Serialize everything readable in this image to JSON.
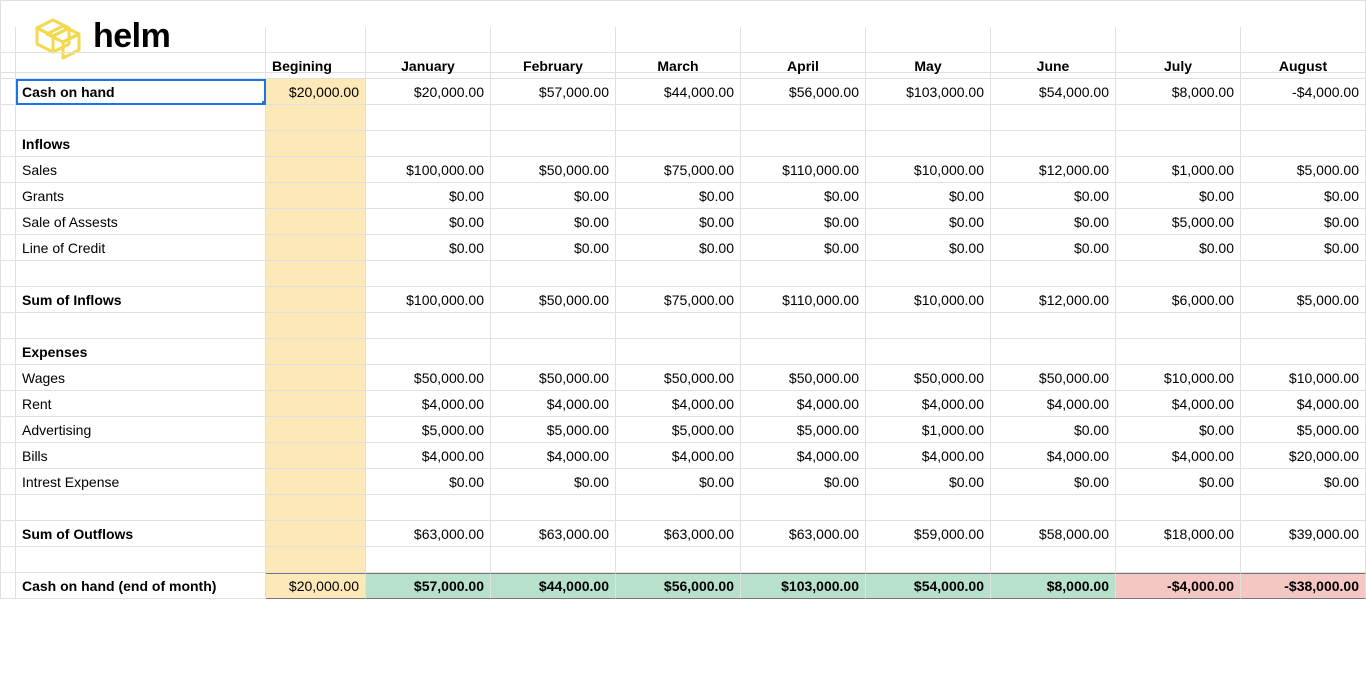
{
  "logo_text": "helm",
  "columns": [
    "Begining",
    "January",
    "February",
    "March",
    "April",
    "May",
    "June",
    "July",
    "August"
  ],
  "rows": {
    "cash_on_hand": {
      "label": "Cash on hand",
      "values": [
        "$20,000.00",
        "$20,000.00",
        "$57,000.00",
        "$44,000.00",
        "$56,000.00",
        "$103,000.00",
        "$54,000.00",
        "$8,000.00",
        "-$4,000.00"
      ]
    },
    "inflows_header": {
      "label": "Inflows"
    },
    "sales": {
      "label": "Sales",
      "values": [
        "",
        "$100,000.00",
        "$50,000.00",
        "$75,000.00",
        "$110,000.00",
        "$10,000.00",
        "$12,000.00",
        "$1,000.00",
        "$5,000.00"
      ]
    },
    "grants": {
      "label": "Grants",
      "values": [
        "",
        "$0.00",
        "$0.00",
        "$0.00",
        "$0.00",
        "$0.00",
        "$0.00",
        "$0.00",
        "$0.00"
      ]
    },
    "sale_assets": {
      "label": "Sale of Assests",
      "values": [
        "",
        "$0.00",
        "$0.00",
        "$0.00",
        "$0.00",
        "$0.00",
        "$0.00",
        "$5,000.00",
        "$0.00"
      ]
    },
    "loc": {
      "label": "Line of Credit",
      "values": [
        "",
        "$0.00",
        "$0.00",
        "$0.00",
        "$0.00",
        "$0.00",
        "$0.00",
        "$0.00",
        "$0.00"
      ]
    },
    "sum_inflows": {
      "label": "Sum of Inflows",
      "values": [
        "",
        "$100,000.00",
        "$50,000.00",
        "$75,000.00",
        "$110,000.00",
        "$10,000.00",
        "$12,000.00",
        "$6,000.00",
        "$5,000.00"
      ]
    },
    "expenses_header": {
      "label": "Expenses"
    },
    "wages": {
      "label": "Wages",
      "values": [
        "",
        "$50,000.00",
        "$50,000.00",
        "$50,000.00",
        "$50,000.00",
        "$50,000.00",
        "$50,000.00",
        "$10,000.00",
        "$10,000.00"
      ]
    },
    "rent": {
      "label": "Rent",
      "values": [
        "",
        "$4,000.00",
        "$4,000.00",
        "$4,000.00",
        "$4,000.00",
        "$4,000.00",
        "$4,000.00",
        "$4,000.00",
        "$4,000.00"
      ]
    },
    "advertising": {
      "label": "Advertising",
      "values": [
        "",
        "$5,000.00",
        "$5,000.00",
        "$5,000.00",
        "$5,000.00",
        "$1,000.00",
        "$0.00",
        "$0.00",
        "$5,000.00"
      ]
    },
    "bills": {
      "label": "Bills",
      "values": [
        "",
        "$4,000.00",
        "$4,000.00",
        "$4,000.00",
        "$4,000.00",
        "$4,000.00",
        "$4,000.00",
        "$4,000.00",
        "$20,000.00"
      ]
    },
    "interest": {
      "label": "Intrest Expense",
      "values": [
        "",
        "$0.00",
        "$0.00",
        "$0.00",
        "$0.00",
        "$0.00",
        "$0.00",
        "$0.00",
        "$0.00"
      ]
    },
    "sum_outflows": {
      "label": "Sum of Outflows",
      "values": [
        "",
        "$63,000.00",
        "$63,000.00",
        "$63,000.00",
        "$63,000.00",
        "$59,000.00",
        "$58,000.00",
        "$18,000.00",
        "$39,000.00"
      ]
    },
    "end_of_month": {
      "label": "Cash on hand (end of month)",
      "values": [
        "$20,000.00",
        "$57,000.00",
        "$44,000.00",
        "$56,000.00",
        "$103,000.00",
        "$54,000.00",
        "$8,000.00",
        "-$4,000.00",
        "-$38,000.00"
      ],
      "neg_flags": [
        false,
        false,
        false,
        false,
        false,
        false,
        false,
        true,
        true
      ]
    }
  },
  "chart_data": {
    "type": "table",
    "title": "Cash Flow Forecast",
    "columns": [
      "Begining",
      "January",
      "February",
      "March",
      "April",
      "May",
      "June",
      "July",
      "August"
    ],
    "rows": [
      {
        "name": "Cash on hand",
        "values": [
          20000,
          20000,
          57000,
          44000,
          56000,
          103000,
          54000,
          8000,
          -4000
        ]
      },
      {
        "name": "Sales",
        "values": [
          null,
          100000,
          50000,
          75000,
          110000,
          10000,
          12000,
          1000,
          5000
        ]
      },
      {
        "name": "Grants",
        "values": [
          null,
          0,
          0,
          0,
          0,
          0,
          0,
          0,
          0
        ]
      },
      {
        "name": "Sale of Assests",
        "values": [
          null,
          0,
          0,
          0,
          0,
          0,
          0,
          5000,
          0
        ]
      },
      {
        "name": "Line of Credit",
        "values": [
          null,
          0,
          0,
          0,
          0,
          0,
          0,
          0,
          0
        ]
      },
      {
        "name": "Sum of Inflows",
        "values": [
          null,
          100000,
          50000,
          75000,
          110000,
          10000,
          12000,
          6000,
          5000
        ]
      },
      {
        "name": "Wages",
        "values": [
          null,
          50000,
          50000,
          50000,
          50000,
          50000,
          50000,
          10000,
          10000
        ]
      },
      {
        "name": "Rent",
        "values": [
          null,
          4000,
          4000,
          4000,
          4000,
          4000,
          4000,
          4000,
          4000
        ]
      },
      {
        "name": "Advertising",
        "values": [
          null,
          5000,
          5000,
          5000,
          5000,
          1000,
          0,
          0,
          5000
        ]
      },
      {
        "name": "Bills",
        "values": [
          null,
          4000,
          4000,
          4000,
          4000,
          4000,
          4000,
          4000,
          20000
        ]
      },
      {
        "name": "Intrest Expense",
        "values": [
          null,
          0,
          0,
          0,
          0,
          0,
          0,
          0,
          0
        ]
      },
      {
        "name": "Sum of Outflows",
        "values": [
          null,
          63000,
          63000,
          63000,
          63000,
          59000,
          58000,
          18000,
          39000
        ]
      },
      {
        "name": "Cash on hand (end of month)",
        "values": [
          20000,
          57000,
          44000,
          56000,
          103000,
          54000,
          8000,
          -4000,
          -38000
        ]
      }
    ]
  }
}
